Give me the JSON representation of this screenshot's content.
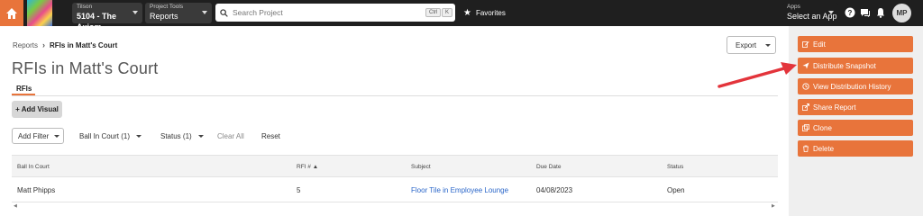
{
  "topbar": {
    "company_label": "Tilson",
    "project": "5104 - The Axiom",
    "tools_label": "Project Tools",
    "tool": "Reports",
    "search_placeholder": "Search Project",
    "kbd_ctrl": "Ctrl",
    "kbd_k": "K",
    "favorites": "Favorites",
    "apps_label": "Apps",
    "apps_value": "Select an App",
    "avatar": "MP"
  },
  "breadcrumb": {
    "parent": "Reports",
    "current": "RFIs in Matt's Court"
  },
  "page": {
    "title": "RFIs in Matt's Court",
    "tab": "RFIs",
    "export": "Export",
    "add_visual": "+ Add Visual"
  },
  "filters": {
    "add_filter": "Add Filter",
    "ball_in_court": "Ball In Court (1)",
    "status": "Status (1)",
    "clear_all": "Clear All",
    "reset": "Reset"
  },
  "table": {
    "columns": [
      "Ball In Court",
      "RFI # ▲",
      "Subject",
      "Due Date",
      "Status"
    ],
    "rows": [
      {
        "ball_in_court": "Matt Phipps",
        "rfi": "5",
        "subject": "Floor Tile in Employee Lounge",
        "due": "04/08/2023",
        "status": "Open"
      }
    ]
  },
  "actions": {
    "edit": "Edit",
    "distribute": "Distribute Snapshot",
    "history": "View Distribution History",
    "share": "Share Report",
    "clone": "Clone",
    "delete": "Delete"
  },
  "colors": {
    "accent": "#e8743b",
    "nav": "#1f1f1f",
    "arrow": "#e3343b",
    "link": "#2a66c9"
  }
}
